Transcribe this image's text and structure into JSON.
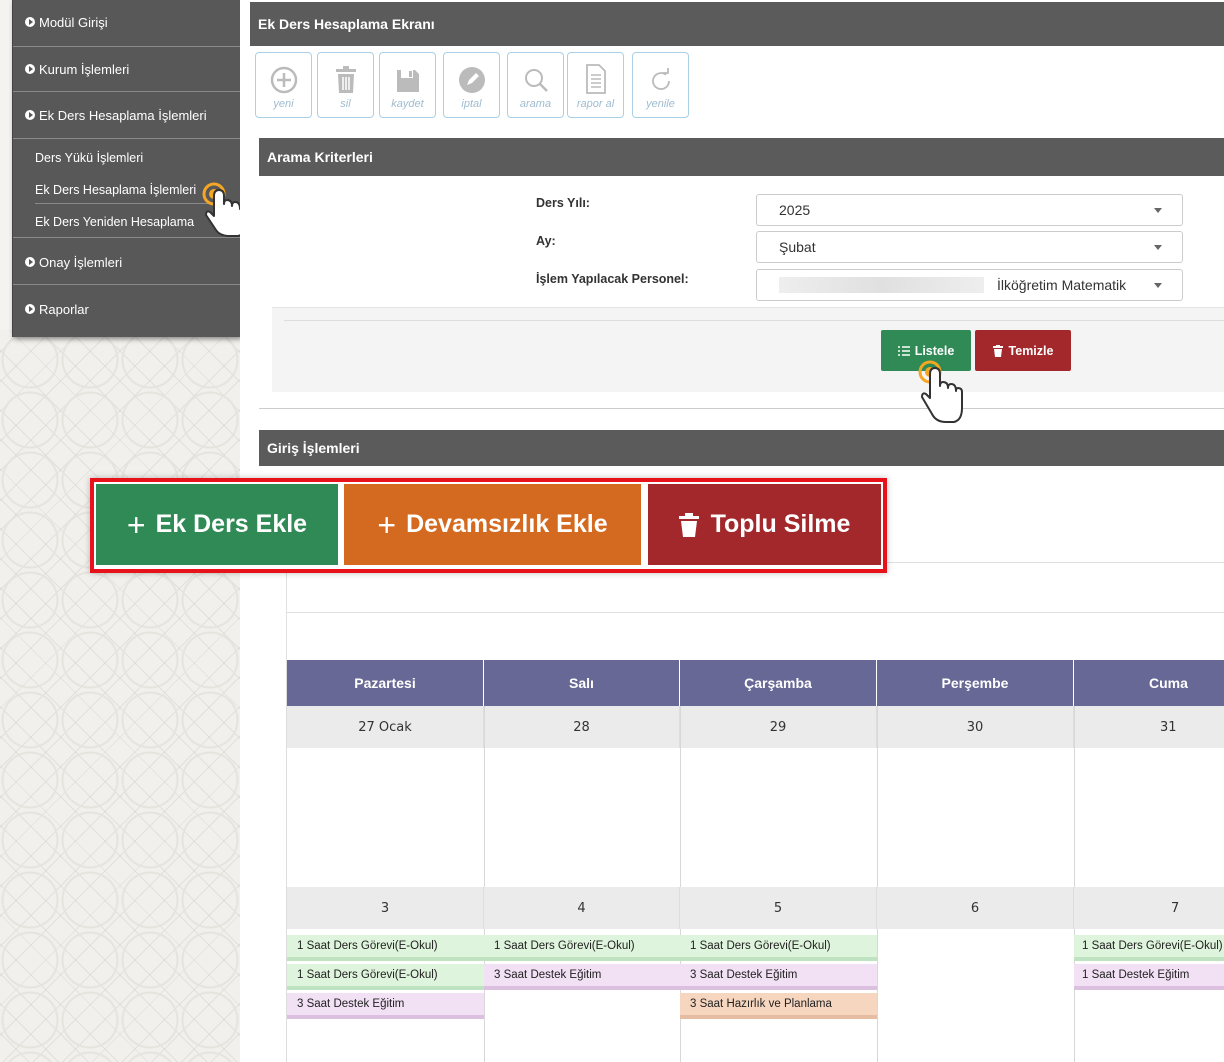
{
  "sidebar": {
    "modul_girisi": "Modül Girişi",
    "kurum_islemleri": "Kurum İşlemleri",
    "ek_ders_hesaplama_islemleri": "Ek Ders Hesaplama İşlemleri",
    "sub_items": [
      "Ders Yükü İşlemleri",
      "Ek Ders Hesaplama İşlemleri",
      "Ek Ders Yeniden Hesaplama"
    ],
    "onay_islemleri": "Onay İşlemleri",
    "raporlar": "Raporlar"
  },
  "page_title": "Ek Ders Hesaplama Ekranı",
  "toolbar": {
    "yeni": "yeni",
    "sil": "sil",
    "kaydet": "kaydet",
    "iptal": "iptal",
    "arama": "arama",
    "rapor_al": "rapor al",
    "yenile": "yenile"
  },
  "search": {
    "title": "Arama Kriterleri",
    "ders_yili_label": "Ders Yılı:",
    "ders_yili_value": "2025",
    "ay_label": "Ay:",
    "ay_value": "Şubat",
    "personel_label": "İşlem Yapılacak Personel:",
    "personel_value": "İlköğretim Matematik",
    "listele": "Listele",
    "temizle": "Temizle"
  },
  "giris": {
    "title": "Giriş İşlemleri",
    "ek_ders_ekle": "Ek Ders Ekle",
    "devamsizlik_ekle": "Devamsızlık Ekle",
    "toplu_silme": "Toplu Silme"
  },
  "colors": {
    "green": "#2f8a55",
    "orange": "#d46a1f",
    "red": "#a2282b",
    "calendar_header": "#686896",
    "highlight_border": "#e8121a"
  },
  "calendar": {
    "days": [
      "Pazartesi",
      "Salı",
      "Çarşamba",
      "Perşembe",
      "Cuma"
    ],
    "week1": [
      "27 Ocak",
      "28",
      "29",
      "30",
      "31"
    ],
    "week2": [
      "3",
      "4",
      "5",
      "6",
      "7"
    ],
    "events": {
      "e1": "1 Saat Ders Görevi(E-Okul)",
      "e2": "1 Saat Ders Görevi(E-Okul)",
      "e3": "3 Saat Destek Eğitim",
      "e4": "1 Saat Ders Görevi(E-Okul)",
      "e5": "3 Saat Destek Eğitim",
      "e6": "1 Saat Ders Görevi(E-Okul)",
      "e7": "3 Saat Destek Eğitim",
      "e8": "3 Saat Hazırlık ve Planlama",
      "e9": "1 Saat Ders Görevi(E-Okul)",
      "e10": "1 Saat Destek Eğitim"
    }
  }
}
